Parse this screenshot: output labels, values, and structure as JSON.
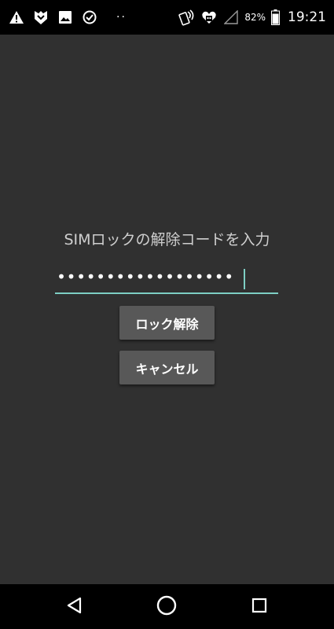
{
  "status_bar": {
    "left_icons": [
      "warning-icon",
      "shield-badge-icon",
      "image-icon",
      "check-circle-icon"
    ],
    "dots": "··",
    "right_icons": [
      "nfc-icon",
      "heart-robot-icon",
      "signal-icon",
      "battery-icon"
    ],
    "battery_percent": "82%",
    "time": "19:21"
  },
  "sim_unlock": {
    "prompt": "SIMロックの解除コードを入力",
    "pin_value": "••••••••••••••••••",
    "unlock_button": "ロック解除",
    "cancel_button": "キャンセル",
    "accent_color": "#7ecfc4"
  },
  "nav_bar": {
    "buttons": [
      "back-icon",
      "home-icon",
      "recent-apps-icon"
    ]
  }
}
